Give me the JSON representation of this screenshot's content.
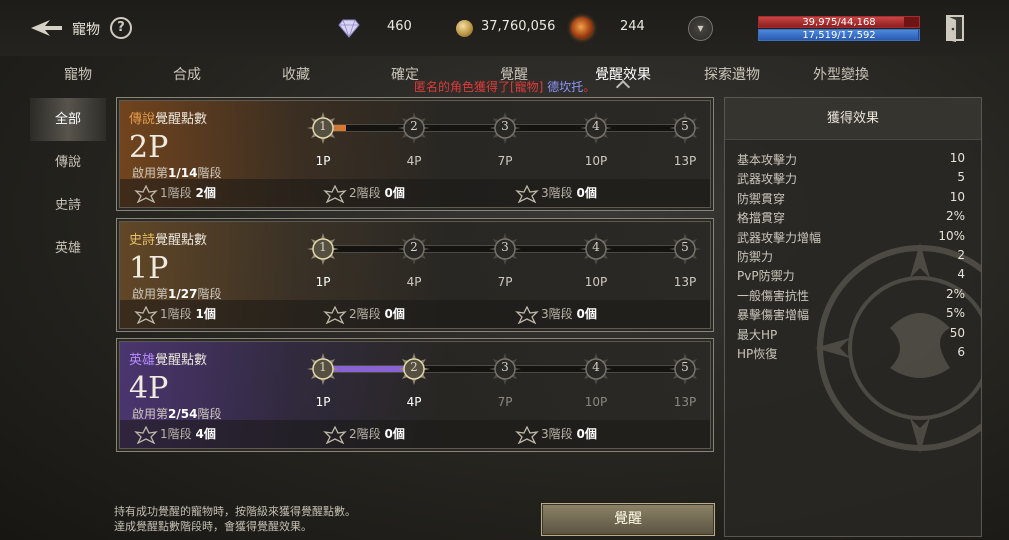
{
  "header": {
    "title": "寵物",
    "help_label": "?",
    "dropdown_label": "▾",
    "resources": {
      "diamond": "460",
      "gold": "37,760,056",
      "orb": "244"
    },
    "hp": {
      "text": "39,975/44,168",
      "fraction": 0.905
    },
    "mp": {
      "text": "17,519/17,592",
      "fraction": 0.996
    }
  },
  "tabs": [
    {
      "label": "寵物"
    },
    {
      "label": "合成"
    },
    {
      "label": "收藏"
    },
    {
      "label": "確定"
    },
    {
      "label": "覺醒"
    },
    {
      "label": "覺醒效果",
      "active": true
    },
    {
      "label": "探索遺物"
    },
    {
      "label": "外型變換"
    }
  ],
  "notice": {
    "prefix": "匿名的角色獲得了[寵物]",
    "name": "德坎托",
    "suffix": "。"
  },
  "filters": [
    {
      "label": "全部",
      "active": true
    },
    {
      "label": "傳說"
    },
    {
      "label": "史詩"
    },
    {
      "label": "英雄"
    }
  ],
  "cards": [
    {
      "grade": "傳說",
      "title_suffix": "覺醒點數",
      "points": "2P",
      "stage_prefix": "啟用第",
      "stage_value": "1/14",
      "stage_suffix": "階段",
      "progress": 0.06,
      "active_nodes": 1,
      "nodes": [
        "1",
        "2",
        "3",
        "4",
        "5"
      ],
      "node_labels": [
        "1P",
        "4P",
        "7P",
        "10P",
        "13P"
      ],
      "tiers": [
        {
          "label": "1階段",
          "count": "2個"
        },
        {
          "label": "2階段",
          "count": "0個"
        },
        {
          "label": "3階段",
          "count": "0個"
        }
      ]
    },
    {
      "grade": "史詩",
      "title_suffix": "覺醒點數",
      "points": "1P",
      "stage_prefix": "啟用第",
      "stage_value": "1/27",
      "stage_suffix": "階段",
      "progress": 0.0,
      "active_nodes": 1,
      "nodes": [
        "1",
        "2",
        "3",
        "4",
        "5"
      ],
      "node_labels": [
        "1P",
        "4P",
        "7P",
        "10P",
        "13P"
      ],
      "tiers": [
        {
          "label": "1階段",
          "count": "1個"
        },
        {
          "label": "2階段",
          "count": "0個"
        },
        {
          "label": "3階段",
          "count": "0個"
        }
      ]
    },
    {
      "grade": "英雄",
      "title_suffix": "覺醒點數",
      "points": "4P",
      "stage_prefix": "啟用第",
      "stage_value": "2/54",
      "stage_suffix": "階段",
      "progress": 0.25,
      "active_nodes": 2,
      "nodes": [
        "1",
        "2",
        "3",
        "4",
        "5"
      ],
      "node_labels": [
        "1P",
        "4P",
        "7P",
        "10P",
        "13P"
      ],
      "tiers": [
        {
          "label": "1階段",
          "count": "4個"
        },
        {
          "label": "2階段",
          "count": "0個"
        },
        {
          "label": "3階段",
          "count": "0個"
        }
      ]
    }
  ],
  "effects": {
    "title": "獲得效果",
    "rows": [
      {
        "name": "基本攻擊力",
        "value": "10"
      },
      {
        "name": "武器攻擊力",
        "value": "5"
      },
      {
        "name": "防禦貫穿",
        "value": "10"
      },
      {
        "name": "格擋貫穿",
        "value": "2%"
      },
      {
        "name": "武器攻擊力增幅",
        "value": "10%"
      },
      {
        "name": "防禦力",
        "value": "2"
      },
      {
        "name": "PvP防禦力",
        "value": "4"
      },
      {
        "name": "一般傷害抗性",
        "value": "2%"
      },
      {
        "name": "暴擊傷害增幅",
        "value": "5%"
      },
      {
        "name": "最大HP",
        "value": "50"
      },
      {
        "name": "HP恢復",
        "value": "6"
      }
    ]
  },
  "footer": {
    "note_line1": "持有成功覺醒的寵物時，按階級來獲得覺醒點數。",
    "note_line2": "達成覺醒點數階段時，會獲得覺醒效果。",
    "awaken_label": "覺醒"
  },
  "colors": {
    "legend_fill": "#d9772a",
    "hero_fill": "#8a63d2",
    "accent_red": "#e03b3b"
  }
}
